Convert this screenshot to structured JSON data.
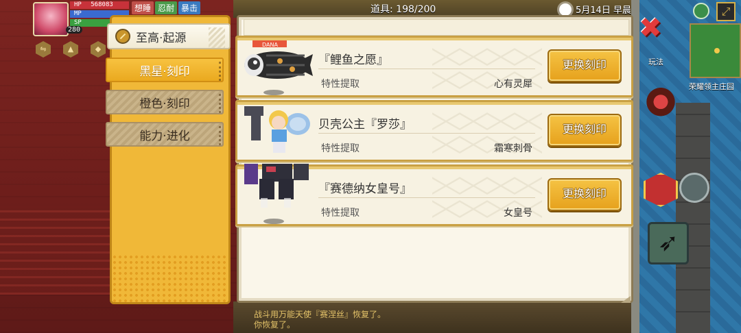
{
  "hud": {
    "hp_label": "HP",
    "hp_value": "568083",
    "mp_label": "MP",
    "sp_label": "SP",
    "level": "280",
    "tags": [
      "想睡",
      "忍耐",
      "暴击"
    ],
    "tag_counts": [
      "1",
      "1"
    ],
    "items": "道具:  198/200",
    "date": "5月14日  早晨",
    "minimap_label": "荣耀领主庄园",
    "play_label": "玩法"
  },
  "categories": {
    "header": "至高·起源",
    "tabs": [
      {
        "label": "黑星·刻印",
        "active": true
      },
      {
        "label": "橙色·刻印",
        "active": false
      },
      {
        "label": "能力·进化",
        "active": false
      }
    ]
  },
  "cards": [
    {
      "name": "『鲤鱼之愿』",
      "attr_label": "特性提取",
      "attr_value": "心有灵犀",
      "button": "更换刻印",
      "sprite": "carp-windsock-icon"
    },
    {
      "name": "贝壳公主『罗莎』",
      "attr_label": "特性提取",
      "attr_value": "霜寒刺骨",
      "button": "更换刻印",
      "sprite": "shell-princess-icon"
    },
    {
      "name": "『赛德纳女皇号』",
      "attr_label": "特性提取",
      "attr_value": "女皇号",
      "button": "更换刻印",
      "sprite": "mech-icon"
    }
  ],
  "chat": {
    "line1": "战斗用万能天使『赛涅丝』恢复了。",
    "line2": "你恢复了。"
  },
  "colors": {
    "accent_gold": "#f0b838",
    "button_gold": "#e6a11c",
    "panel_bg": "#faf6ea",
    "close_red": "#e23b3b"
  }
}
